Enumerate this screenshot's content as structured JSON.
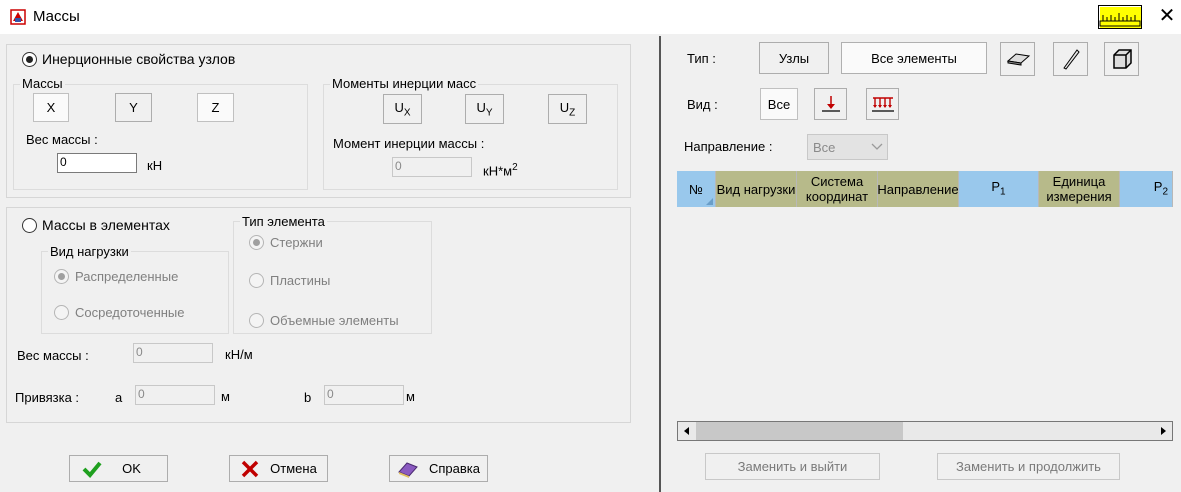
{
  "window": {
    "title": "Массы",
    "close_glyph": "✕"
  },
  "nodes": {
    "radio_label": "Инерционные свойства узлов",
    "masses": {
      "label": "Массы",
      "x": "X",
      "y": "Y",
      "z": "Z",
      "weight_label": "Вес массы :",
      "weight_value": "0",
      "weight_unit": "кН"
    },
    "moments": {
      "label": "Моменты инерции масс",
      "ux": "U",
      "ux_sub": "X",
      "uy": "U",
      "uy_sub": "Y",
      "uz": "U",
      "uz_sub": "Z",
      "moment_label": "Момент инерции массы :",
      "moment_value": "0",
      "moment_unit": "кН*м",
      "moment_unit_sup": "2"
    }
  },
  "elements": {
    "radio_label": "Массы в элементах",
    "load_type": {
      "label": "Вид нагрузки",
      "distributed": "Распределенные",
      "concentrated": "Сосредоточенные"
    },
    "element_type": {
      "label": "Тип элемента",
      "rods": "Стержни",
      "plates": "Пластины",
      "solids": "Объемные элементы"
    },
    "weight_label": "Вес массы :",
    "weight_value": "0",
    "weight_unit": "кН/м",
    "binding_label": "Привязка :",
    "a_label": "a",
    "a_value": "0",
    "a_unit": "м",
    "b_label": "b",
    "b_value": "0",
    "b_unit": "м"
  },
  "buttons": {
    "ok": "OK",
    "cancel": "Отмена",
    "help": "Справка"
  },
  "right": {
    "type_label": "Тип :",
    "nodes_btn": "Узлы",
    "all_elements_btn": "Все элементы",
    "view_label": "Вид :",
    "view_all": "Все",
    "direction_label": "Направление :",
    "direction_value": "Все",
    "table_headers": [
      {
        "t": "№"
      },
      {
        "t": "Вид нагрузки"
      },
      {
        "t": "Система координат"
      },
      {
        "t": "Направление"
      },
      {
        "t": "P",
        "sub": "1"
      },
      {
        "t": "Единица измерения"
      },
      {
        "t": "P",
        "sub": "2"
      }
    ],
    "replace_exit": "Заменить и выйти",
    "replace_continue": "Заменить и продолжить"
  },
  "colors": {
    "header_olive": "#b7ba8a",
    "header_blue": "#99c8ec",
    "scroll_thumb": "#c8c8c8",
    "ruler": "#ffff00",
    "ok_check": "#1fa01f",
    "cancel_x": "#c00000",
    "arrow_red": "#c00000"
  }
}
